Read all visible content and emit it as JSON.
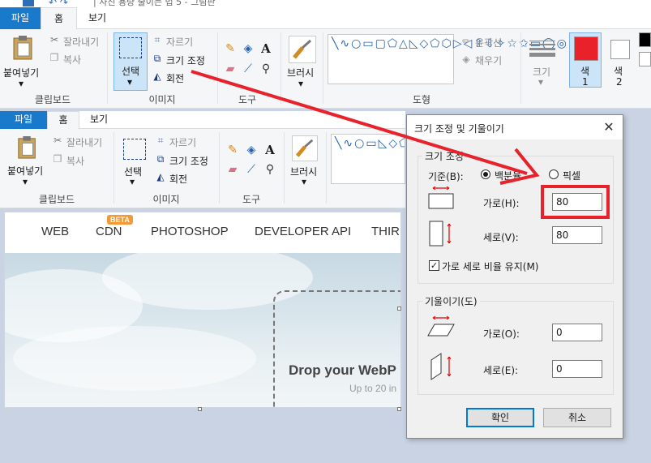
{
  "window": {
    "title": "| 사진 용량 줄이는 법 5 - 그림판"
  },
  "ribbon": {
    "tabs": {
      "file": "파일",
      "home": "홈",
      "view": "보기"
    },
    "clipboard": {
      "paste": "붙여넣기",
      "cut": "잘라내기",
      "copy": "복사",
      "label": "클립보드"
    },
    "image": {
      "select": "선택",
      "crop": "자르기",
      "resize": "크기 조정",
      "rotate": "회전",
      "label": "이미지"
    },
    "tools": {
      "label": "도구"
    },
    "brushes": {
      "label": "브러시"
    },
    "shapes": {
      "outline": "윤곽선",
      "fill": "채우기",
      "label": "도형"
    },
    "size": {
      "label": "크기"
    },
    "color1": {
      "label": "색",
      "index": "1",
      "value": "#e8212a"
    },
    "color2": {
      "label": "색",
      "index": "2",
      "value": "#ffffff"
    }
  },
  "inner_ribbon": {
    "tabs": {
      "file": "파일",
      "home": "홈",
      "view": "보기"
    },
    "clipboard": {
      "paste": "붙여넣기",
      "cut": "잘라내기",
      "copy": "복사",
      "label": "클립보드"
    },
    "image": {
      "select": "선택",
      "crop": "자르기",
      "resize": "크기 조정",
      "rotate": "회전",
      "label": "이미지"
    },
    "tools": {
      "label": "도구"
    },
    "brushes": {
      "label": "브러시"
    }
  },
  "webpage": {
    "nav": [
      "WEB",
      "CDN",
      "PHOTOSHOP",
      "DEVELOPER API",
      "THIR"
    ],
    "beta_badge": "BETA",
    "drop_title": "Drop your WebP",
    "drop_subtitle": "Up to 20 in"
  },
  "dialog": {
    "title": "크기 조정 및 기울이기",
    "resize_legend": "크기 조정",
    "basis_label": "기준(B):",
    "percent_option": "백분율",
    "pixel_option": "픽셀",
    "horizontal_label": "가로(H):",
    "horizontal_value": "80",
    "vertical_label": "세로(V):",
    "vertical_value": "80",
    "keep_ratio": "가로 세로 비율 유지(M)",
    "skew_legend": "기울이기(도)",
    "skew_h_label": "가로(O):",
    "skew_h_value": "0",
    "skew_v_label": "세로(E):",
    "skew_v_value": "0",
    "ok": "확인",
    "cancel": "취소"
  },
  "annotation_color": "#e8212a"
}
